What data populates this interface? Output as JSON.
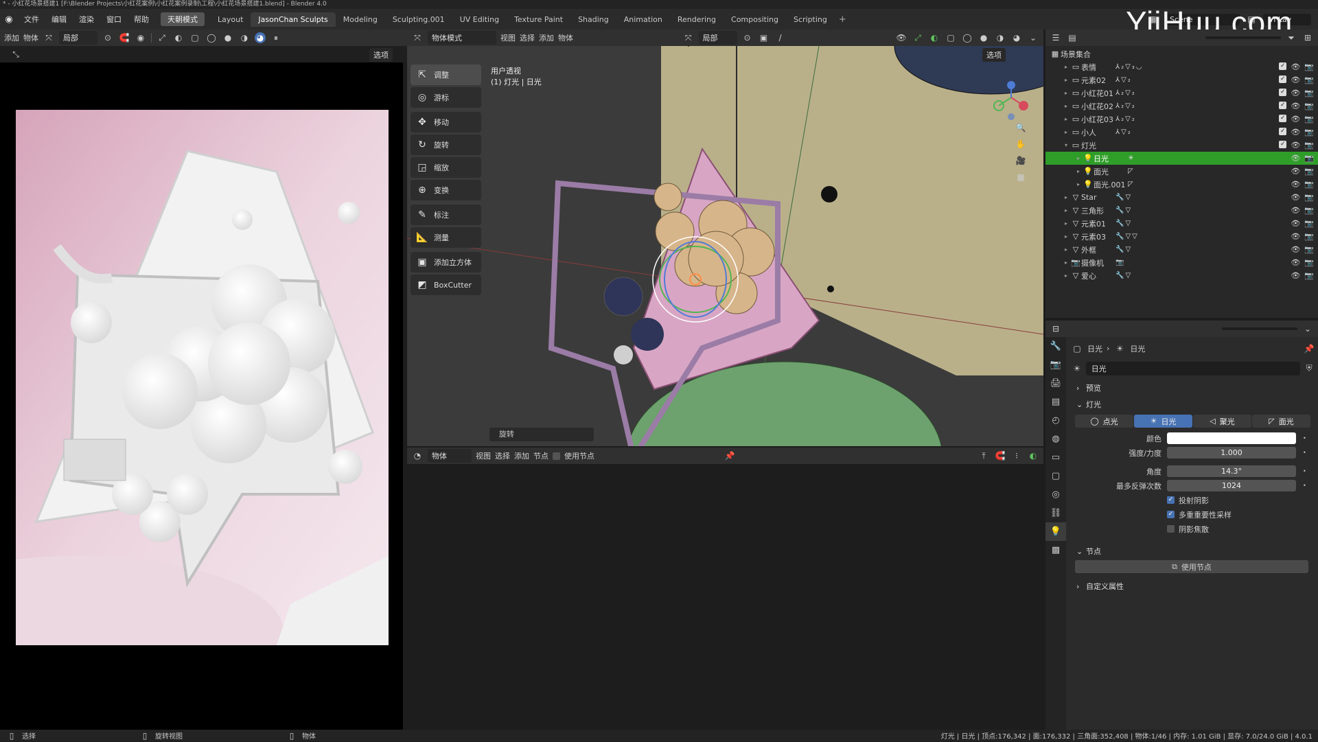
{
  "window": {
    "title": "* - 小红花场景搭建1 [F:\\Blender Projects\\小红花案例\\小红花案例录制\\工程\\小红花场景搭建1.blend] - Blender 4.0"
  },
  "menubar": {
    "menus": [
      "文件",
      "编辑",
      "渲染",
      "窗口",
      "帮助"
    ],
    "mode_button": "天朝模式",
    "workspaces": [
      "Layout",
      "JasonChan Sculpts",
      "Modeling",
      "Sculpting.001",
      "UV Editing",
      "Texture Paint",
      "Shading",
      "Animation",
      "Rendering",
      "Compositing",
      "Scripting"
    ],
    "active_workspace": "JasonChan Sculpts",
    "scene": "Scene",
    "view_layer": "Vi Lay",
    "watermark": "YiiHuu.com"
  },
  "image_editor": {
    "header": {
      "add": "添加",
      "object": "物体",
      "orientation": "局部",
      "options": "选项"
    }
  },
  "viewport": {
    "header": {
      "mode": "物体模式",
      "view": "视图",
      "select": "选择",
      "add": "添加",
      "object": "物体",
      "orientation": "局部",
      "options": "选项"
    },
    "overlay_title": "用户透视",
    "overlay_subtitle": "(1) 灯光 | 日光",
    "last_op": "旋转",
    "tools": [
      {
        "icon": "select-icon",
        "glyph": "⇱",
        "label": "调整",
        "active": true
      },
      {
        "icon": "cursor-icon",
        "glyph": "◎",
        "label": "游标",
        "active": false
      },
      {
        "icon": "move-icon",
        "glyph": "✥",
        "label": "移动",
        "active": false
      },
      {
        "icon": "rotate-icon",
        "glyph": "↻",
        "label": "旋转",
        "active": false
      },
      {
        "icon": "scale-icon",
        "glyph": "◲",
        "label": "缩放",
        "active": false
      },
      {
        "icon": "transform-icon",
        "glyph": "⊕",
        "label": "变换",
        "active": false
      },
      {
        "icon": "annotate-icon",
        "glyph": "✎",
        "label": "标注",
        "active": false
      },
      {
        "icon": "measure-icon",
        "glyph": "📐",
        "label": "测量",
        "active": false
      },
      {
        "icon": "add-cube-icon",
        "glyph": "▣",
        "label": "添加立方体",
        "active": false
      },
      {
        "icon": "boxcutter-icon",
        "glyph": "◩",
        "label": "BoxCutter",
        "active": false
      }
    ]
  },
  "node_editor": {
    "header": {
      "object": "物体",
      "view": "视图",
      "select": "选择",
      "add": "添加",
      "node": "节点",
      "use_nodes": "使用节点"
    }
  },
  "outliner": {
    "root": "场景集合",
    "rows": [
      {
        "name": "表情",
        "indent": 1,
        "icon": "collection-icon",
        "mods": "⅄₂▽₃◡",
        "checkbox": true,
        "selected": false
      },
      {
        "name": "元素02",
        "indent": 1,
        "icon": "collection-icon",
        "mods": "⅄▽₂",
        "checkbox": true,
        "selected": false
      },
      {
        "name": "小红花01",
        "indent": 1,
        "icon": "collection-icon",
        "mods": "⅄₂▽₂",
        "checkbox": true,
        "selected": false
      },
      {
        "name": "小红花02",
        "indent": 1,
        "icon": "collection-icon",
        "mods": "⅄₂▽₂",
        "checkbox": true,
        "selected": false
      },
      {
        "name": "小红花03",
        "indent": 1,
        "icon": "collection-icon",
        "mods": "⅄₂▽₂",
        "checkbox": true,
        "selected": false
      },
      {
        "name": "小人",
        "indent": 1,
        "icon": "collection-icon",
        "mods": "⅄▽₂",
        "checkbox": true,
        "selected": false
      },
      {
        "name": "灯光",
        "indent": 1,
        "icon": "collection-icon",
        "mods": "",
        "checkbox": true,
        "selected": false,
        "expanded": true
      },
      {
        "name": "日光",
        "indent": 2,
        "icon": "light-icon",
        "mods": "☀",
        "checkbox": false,
        "selected": true
      },
      {
        "name": "面光",
        "indent": 2,
        "icon": "light-icon",
        "mods": "◸",
        "checkbox": false,
        "selected": false
      },
      {
        "name": "面光.001",
        "indent": 2,
        "icon": "light-icon",
        "mods": "◸",
        "checkbox": false,
        "selected": false
      },
      {
        "name": "Star",
        "indent": 1,
        "icon": "mesh-icon",
        "mods": "🔧▽",
        "checkbox": false,
        "selected": false
      },
      {
        "name": "三角形",
        "indent": 1,
        "icon": "mesh-icon",
        "mods": "🔧▽",
        "checkbox": false,
        "selected": false
      },
      {
        "name": "元素01",
        "indent": 1,
        "icon": "mesh-icon",
        "mods": "🔧▽",
        "checkbox": false,
        "selected": false
      },
      {
        "name": "元素03",
        "indent": 1,
        "icon": "mesh-icon",
        "mods": "🔧▽▽",
        "checkbox": false,
        "selected": false
      },
      {
        "name": "外框",
        "indent": 1,
        "icon": "mesh-icon",
        "mods": "🔧▽",
        "checkbox": false,
        "selected": false
      },
      {
        "name": "摄像机",
        "indent": 1,
        "icon": "camera-icon",
        "mods": "📷",
        "checkbox": false,
        "selected": false
      },
      {
        "name": "爱心",
        "indent": 1,
        "icon": "mesh-icon",
        "mods": "🔧▽",
        "checkbox": false,
        "selected": false
      }
    ]
  },
  "properties": {
    "breadcrumb": [
      "日光",
      "日光"
    ],
    "datablock": "日光",
    "preview_label": "预览",
    "light_section": "灯光",
    "light_types": [
      {
        "label": "点光",
        "icon": "point-light-icon",
        "glyph": "◯",
        "active": false
      },
      {
        "label": "日光",
        "icon": "sun-light-icon",
        "glyph": "☀",
        "active": true
      },
      {
        "label": "聚光",
        "icon": "spot-light-icon",
        "glyph": "◁",
        "active": false
      },
      {
        "label": "面光",
        "icon": "area-light-icon",
        "glyph": "◸",
        "active": false
      }
    ],
    "color_label": "颜色",
    "color_value": "#ffffff",
    "strength_label": "强度/力度",
    "strength": "1.000",
    "angle_label": "角度",
    "angle": "14.3°",
    "bounces_label": "最多反弹次数",
    "bounces": "1024",
    "cast_shadow": "投射阴影",
    "mis": "多重重要性采样",
    "shadow_caustics": "阴影焦散",
    "nodes_section": "节点",
    "use_nodes": "使用节点",
    "custom_props": "自定义属性"
  },
  "statusbar": {
    "select": "选择",
    "rotate_view": "旋转视图",
    "object": "物体",
    "stats": "灯光 | 日光 | 顶点:176,342 | 面:176,332 | 三角面:352,408 | 物体:1/46 | 内存: 1.01 GiB | 显存: 7.0/24.0 GiB | 4.0.1"
  },
  "colors": {
    "selected_green": "#2f9e29",
    "active_blue": "#4772b3",
    "poster_pink": "#e7c3d2"
  }
}
